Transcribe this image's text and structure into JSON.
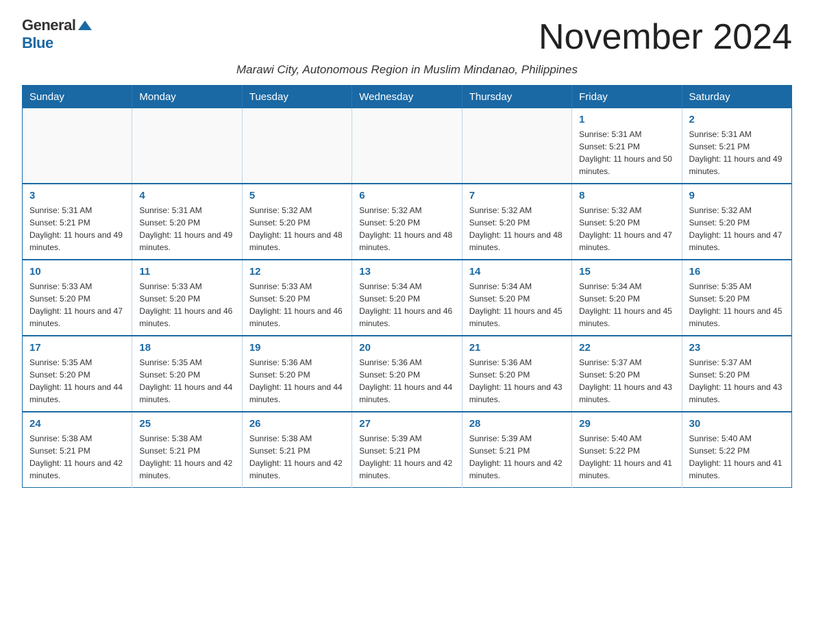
{
  "logo": {
    "general": "General",
    "blue": "Blue"
  },
  "title": "November 2024",
  "subtitle": "Marawi City, Autonomous Region in Muslim Mindanao, Philippines",
  "weekdays": [
    "Sunday",
    "Monday",
    "Tuesday",
    "Wednesday",
    "Thursday",
    "Friday",
    "Saturday"
  ],
  "weeks": [
    [
      {
        "day": "",
        "info": ""
      },
      {
        "day": "",
        "info": ""
      },
      {
        "day": "",
        "info": ""
      },
      {
        "day": "",
        "info": ""
      },
      {
        "day": "",
        "info": ""
      },
      {
        "day": "1",
        "info": "Sunrise: 5:31 AM\nSunset: 5:21 PM\nDaylight: 11 hours and 50 minutes."
      },
      {
        "day": "2",
        "info": "Sunrise: 5:31 AM\nSunset: 5:21 PM\nDaylight: 11 hours and 49 minutes."
      }
    ],
    [
      {
        "day": "3",
        "info": "Sunrise: 5:31 AM\nSunset: 5:21 PM\nDaylight: 11 hours and 49 minutes."
      },
      {
        "day": "4",
        "info": "Sunrise: 5:31 AM\nSunset: 5:20 PM\nDaylight: 11 hours and 49 minutes."
      },
      {
        "day": "5",
        "info": "Sunrise: 5:32 AM\nSunset: 5:20 PM\nDaylight: 11 hours and 48 minutes."
      },
      {
        "day": "6",
        "info": "Sunrise: 5:32 AM\nSunset: 5:20 PM\nDaylight: 11 hours and 48 minutes."
      },
      {
        "day": "7",
        "info": "Sunrise: 5:32 AM\nSunset: 5:20 PM\nDaylight: 11 hours and 48 minutes."
      },
      {
        "day": "8",
        "info": "Sunrise: 5:32 AM\nSunset: 5:20 PM\nDaylight: 11 hours and 47 minutes."
      },
      {
        "day": "9",
        "info": "Sunrise: 5:32 AM\nSunset: 5:20 PM\nDaylight: 11 hours and 47 minutes."
      }
    ],
    [
      {
        "day": "10",
        "info": "Sunrise: 5:33 AM\nSunset: 5:20 PM\nDaylight: 11 hours and 47 minutes."
      },
      {
        "day": "11",
        "info": "Sunrise: 5:33 AM\nSunset: 5:20 PM\nDaylight: 11 hours and 46 minutes."
      },
      {
        "day": "12",
        "info": "Sunrise: 5:33 AM\nSunset: 5:20 PM\nDaylight: 11 hours and 46 minutes."
      },
      {
        "day": "13",
        "info": "Sunrise: 5:34 AM\nSunset: 5:20 PM\nDaylight: 11 hours and 46 minutes."
      },
      {
        "day": "14",
        "info": "Sunrise: 5:34 AM\nSunset: 5:20 PM\nDaylight: 11 hours and 45 minutes."
      },
      {
        "day": "15",
        "info": "Sunrise: 5:34 AM\nSunset: 5:20 PM\nDaylight: 11 hours and 45 minutes."
      },
      {
        "day": "16",
        "info": "Sunrise: 5:35 AM\nSunset: 5:20 PM\nDaylight: 11 hours and 45 minutes."
      }
    ],
    [
      {
        "day": "17",
        "info": "Sunrise: 5:35 AM\nSunset: 5:20 PM\nDaylight: 11 hours and 44 minutes."
      },
      {
        "day": "18",
        "info": "Sunrise: 5:35 AM\nSunset: 5:20 PM\nDaylight: 11 hours and 44 minutes."
      },
      {
        "day": "19",
        "info": "Sunrise: 5:36 AM\nSunset: 5:20 PM\nDaylight: 11 hours and 44 minutes."
      },
      {
        "day": "20",
        "info": "Sunrise: 5:36 AM\nSunset: 5:20 PM\nDaylight: 11 hours and 44 minutes."
      },
      {
        "day": "21",
        "info": "Sunrise: 5:36 AM\nSunset: 5:20 PM\nDaylight: 11 hours and 43 minutes."
      },
      {
        "day": "22",
        "info": "Sunrise: 5:37 AM\nSunset: 5:20 PM\nDaylight: 11 hours and 43 minutes."
      },
      {
        "day": "23",
        "info": "Sunrise: 5:37 AM\nSunset: 5:20 PM\nDaylight: 11 hours and 43 minutes."
      }
    ],
    [
      {
        "day": "24",
        "info": "Sunrise: 5:38 AM\nSunset: 5:21 PM\nDaylight: 11 hours and 42 minutes."
      },
      {
        "day": "25",
        "info": "Sunrise: 5:38 AM\nSunset: 5:21 PM\nDaylight: 11 hours and 42 minutes."
      },
      {
        "day": "26",
        "info": "Sunrise: 5:38 AM\nSunset: 5:21 PM\nDaylight: 11 hours and 42 minutes."
      },
      {
        "day": "27",
        "info": "Sunrise: 5:39 AM\nSunset: 5:21 PM\nDaylight: 11 hours and 42 minutes."
      },
      {
        "day": "28",
        "info": "Sunrise: 5:39 AM\nSunset: 5:21 PM\nDaylight: 11 hours and 42 minutes."
      },
      {
        "day": "29",
        "info": "Sunrise: 5:40 AM\nSunset: 5:22 PM\nDaylight: 11 hours and 41 minutes."
      },
      {
        "day": "30",
        "info": "Sunrise: 5:40 AM\nSunset: 5:22 PM\nDaylight: 11 hours and 41 minutes."
      }
    ]
  ]
}
